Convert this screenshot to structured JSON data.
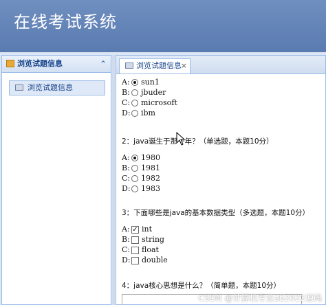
{
  "app": {
    "title": "在线考试系统"
  },
  "west": {
    "header": "浏览试题信息",
    "collapse_glyph": "⌃",
    "nav_item": "浏览试题信息"
  },
  "tab": {
    "label": "浏览试题信息",
    "close_glyph": "×"
  },
  "questions": [
    {
      "text": "",
      "options": [
        {
          "letter": "A:",
          "label": "sun1",
          "checked": true
        },
        {
          "letter": "B:",
          "label": "jbuder",
          "checked": false
        },
        {
          "letter": "C:",
          "label": "microsoft",
          "checked": false
        },
        {
          "letter": "D:",
          "label": "ibm",
          "checked": false
        }
      ]
    },
    {
      "text": "2：java诞生于那一年？（单选题，本题10分）",
      "options": [
        {
          "letter": "A:",
          "label": "1980",
          "checked": true
        },
        {
          "letter": "B:",
          "label": "1981",
          "checked": false
        },
        {
          "letter": "C:",
          "label": "1982",
          "checked": false
        },
        {
          "letter": "D:",
          "label": "1983",
          "checked": false
        }
      ]
    },
    {
      "text": "3：下面哪些是java的基本数据类型（多选题，本题10分）",
      "options": [
        {
          "letter": "A:",
          "label": "int",
          "checked": true
        },
        {
          "letter": "B:",
          "label": "string",
          "checked": false
        },
        {
          "letter": "C:",
          "label": "float",
          "checked": false
        },
        {
          "letter": "D:",
          "label": "double",
          "checked": false
        }
      ]
    },
    {
      "text": "4：java核心思想是什么？（简单题，本题10分）"
    }
  ],
  "checkmark_glyph": "✓",
  "watermark": "CSDN @计算机专业ab2022源码"
}
